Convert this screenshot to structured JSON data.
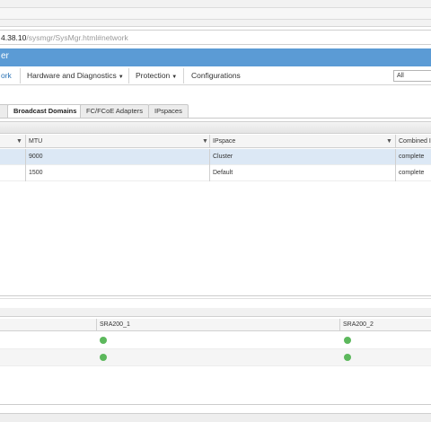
{
  "browser": {
    "address_host": "4.38.10",
    "address_path": "/sysmgr/SysMgr.html#network"
  },
  "app": {
    "title": "er"
  },
  "nav": {
    "items": [
      {
        "label": "ork",
        "active": true,
        "caret": false
      },
      {
        "label": "Hardware and Diagnostics",
        "active": false,
        "caret": true
      },
      {
        "label": "Protection",
        "active": false,
        "caret": true
      },
      {
        "label": "Configurations",
        "active": false,
        "caret": false
      }
    ],
    "search_scope": "All"
  },
  "tabs": [
    {
      "label": "",
      "active": false
    },
    {
      "label": "Broadcast Domains",
      "active": true
    },
    {
      "label": "FC/FCoE Adapters",
      "active": false
    },
    {
      "label": "IPspaces",
      "active": false
    }
  ],
  "grid": {
    "columns": [
      "",
      "MTU",
      "IPspace",
      "Combined I"
    ],
    "rows": [
      {
        "mtu": "9000",
        "ipspace": "Cluster",
        "status": "complete",
        "selected": true
      },
      {
        "mtu": "1500",
        "ipspace": "Default",
        "status": "complete",
        "selected": false
      }
    ]
  },
  "ports_panel": {
    "columns": [
      "",
      "SRA200_1",
      "SRA200_2"
    ],
    "rows": [
      {
        "node1": "up",
        "node2": "up"
      },
      {
        "node1": "up",
        "node2": "up"
      }
    ],
    "status_color": "#5cb85c"
  }
}
